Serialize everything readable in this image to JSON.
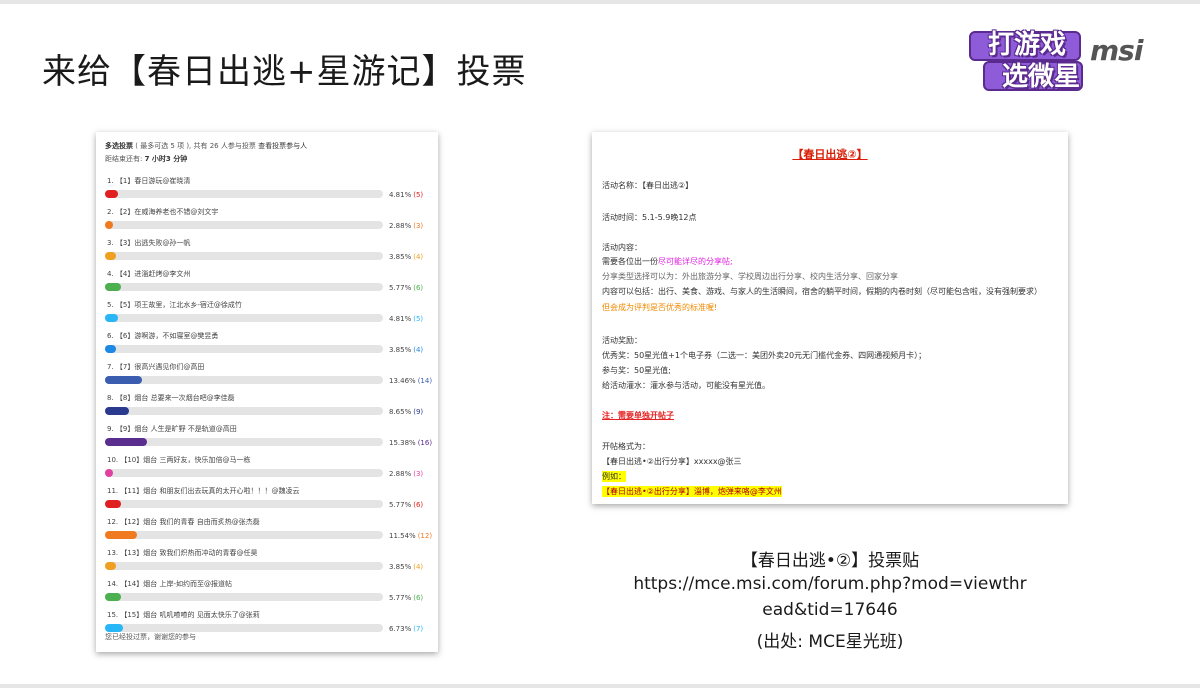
{
  "slide": {
    "title": "来给【春日出逃+星游记】投票"
  },
  "brand": {
    "line1": "打游戏",
    "line2": "选微星",
    "msi": "msi"
  },
  "poll": {
    "header_type": "多选投票",
    "header_rest": "( 最多可选 5 项 ), 共有 26 人参与投票",
    "header_link": "查看投票参与人",
    "remain_label": "距结束还有:",
    "remain_value": "7 小时3 分钟",
    "footer": "您已经投过票，谢谢您的参与",
    "options": [
      {
        "label": "1. 【1】春日游玩@崔晓清",
        "percent": 4.81,
        "pct": "4.81%",
        "count": "(5)",
        "color": "#e02020"
      },
      {
        "label": "2. 【2】在威海养老也不错@刘文宇",
        "percent": 2.88,
        "pct": "2.88%",
        "count": "(3)",
        "color": "#f07a20"
      },
      {
        "label": "3. 【3】出逃失败@孙一帆",
        "percent": 3.85,
        "pct": "3.85%",
        "count": "(4)",
        "color": "#f0a020"
      },
      {
        "label": "4. 【4】进淄赶烤@李文州",
        "percent": 5.77,
        "pct": "5.77%",
        "count": "(6)",
        "color": "#4caf50"
      },
      {
        "label": "5. 【5】项王故里，江北水乡-宿迁@徐成竹",
        "percent": 4.81,
        "pct": "4.81%",
        "count": "(5)",
        "color": "#29b6f6"
      },
      {
        "label": "6. 【6】游啊游，不如寝室@樊昱勇",
        "percent": 3.85,
        "pct": "3.85%",
        "count": "(4)",
        "color": "#1e88e5"
      },
      {
        "label": "7. 【7】很高兴遇见你们@高田",
        "percent": 13.46,
        "pct": "13.46%",
        "count": "(14)",
        "color": "#3a5db0"
      },
      {
        "label": "8. 【8】烟台 总要来一次烟台吧@李佳磊",
        "percent": 8.65,
        "pct": "8.65%",
        "count": "(9)",
        "color": "#2a3a8f"
      },
      {
        "label": "9. 【9】烟台 人生是旷野 不是轨道@高田",
        "percent": 15.38,
        "pct": "15.38%",
        "count": "(16)",
        "color": "#5b2d8e"
      },
      {
        "label": "10. 【10】烟台 三两好友，快乐加倍@马一栋",
        "percent": 2.88,
        "pct": "2.88%",
        "count": "(3)",
        "color": "#e040a0"
      },
      {
        "label": "11. 【11】烟台 和朋友们出去玩真的太开心啦！！！@魏凌云",
        "percent": 5.77,
        "pct": "5.77%",
        "count": "(6)",
        "color": "#e02020"
      },
      {
        "label": "12. 【12】烟台 我们的青春 自由而炙热@张杰磊",
        "percent": 11.54,
        "pct": "11.54%",
        "count": "(12)",
        "color": "#f07a20"
      },
      {
        "label": "13. 【13】烟台 致我们炽热而冲动的青春@任昊",
        "percent": 3.85,
        "pct": "3.85%",
        "count": "(4)",
        "color": "#f0a020"
      },
      {
        "label": "14. 【14】烟台 上岸-如约而至@报道帖",
        "percent": 5.77,
        "pct": "5.77%",
        "count": "(6)",
        "color": "#4caf50"
      },
      {
        "label": "15. 【15】烟台 叽叽喳喳的 见面太快乐了@张莉",
        "percent": 6.73,
        "pct": "6.73%",
        "count": "(7)",
        "color": "#29b6f6"
      }
    ]
  },
  "post": {
    "title": "【春日出逃②】",
    "name_line": "活动名称：【春日出逃②】",
    "time_line": "活动时间：5.1-5.9晚12点",
    "content_label": "活动内容：",
    "content_1a": "需要各位出一份",
    "content_1b": "尽可能详尽的分享帖;",
    "content_2": "分享类型选择可以为：外出旅游分享、学校周边出行分享、校内生活分享、回家分享",
    "content_3": "内容可以包括：出行、美食、游戏、与家人的生活瞬间，宿舍的躺平时间，假期的内卷时刻（尽可能包含啦，没有强制要求）",
    "content_4": "但会成为评判是否优秀的标准喔!",
    "reward_label": "活动奖励：",
    "reward_1": "优秀奖：50星光值+1个电子券（二选一：美团外卖20元无门槛代金券、四网通视频月卡）；",
    "reward_2": "参与奖：50星光值;",
    "reward_3": "给活动灌水：灌水参与活动，可能没有星光值。",
    "note": "注：需要单独开帖子",
    "format_label": "开帖格式为：",
    "format_line": "【春日出逃•②出行分享】xxxxx@张三",
    "example_label": "例如：",
    "example_line": "【春日出逃•②出行分享】淄博，炮弹来咯@李文州"
  },
  "caption": {
    "line1": "【春日出逃•②】投票贴",
    "line2": "https://mce.msi.com/forum.php?mod=viewthr",
    "line3": "ead&tid=17646",
    "line4": "(出处: MCE星光班)"
  }
}
